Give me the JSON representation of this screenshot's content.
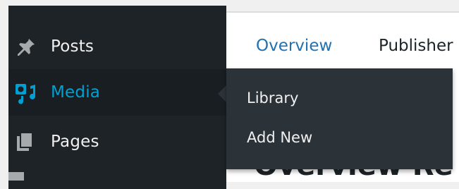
{
  "sidebar": {
    "items": [
      {
        "label": "Posts",
        "icon": "pin-icon"
      },
      {
        "label": "Media",
        "icon": "media-icon"
      },
      {
        "label": "Pages",
        "icon": "pages-icon"
      }
    ]
  },
  "tabs": [
    {
      "label": "Overview"
    },
    {
      "label": "Publisher"
    }
  ],
  "content": {
    "heading": "Overview Re"
  },
  "flyout": {
    "items": [
      {
        "label": "Library"
      },
      {
        "label": "Add New"
      }
    ]
  },
  "colors": {
    "sidebar_bg": "#1d2327",
    "accent": "#00a0d2",
    "flyout_bg": "#2c3338",
    "link": "#2271b1"
  }
}
